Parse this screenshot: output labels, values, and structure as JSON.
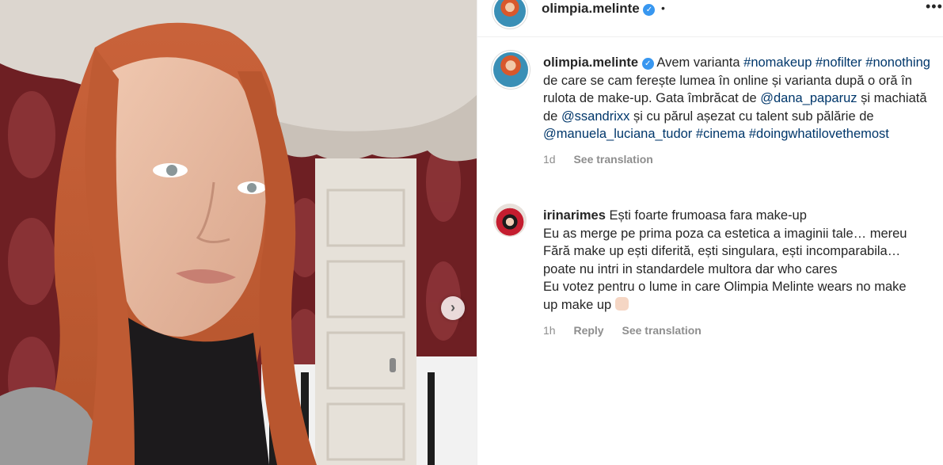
{
  "post": {
    "author": {
      "username": "olimpia.melinte",
      "verified": true
    },
    "header_separator": "•",
    "more_options": "•••",
    "caption": {
      "segments": [
        {
          "type": "text",
          "text": "Avem varianta "
        },
        {
          "type": "tag",
          "text": "#nomakeup"
        },
        {
          "type": "text",
          "text": " "
        },
        {
          "type": "tag",
          "text": "#nofilter"
        },
        {
          "type": "text",
          "text": " "
        },
        {
          "type": "tag",
          "text": "#nonothing"
        },
        {
          "type": "text",
          "text": " de care se cam ferește lumea în online și varianta după o oră în rulota de make-up. Gata îmbrăcat de "
        },
        {
          "type": "tag",
          "text": "@dana_paparuz"
        },
        {
          "type": "text",
          "text": " și machiată de "
        },
        {
          "type": "tag",
          "text": "@ssandrixx"
        },
        {
          "type": "text",
          "text": " și cu părul așezat cu talent sub pălărie de "
        },
        {
          "type": "tag",
          "text": "@manuela_luciana_tudor"
        },
        {
          "type": "text",
          "text": " "
        },
        {
          "type": "tag",
          "text": "#cinema"
        },
        {
          "type": "text",
          "text": " "
        },
        {
          "type": "tag",
          "text": "#doingwhatilovethemost"
        }
      ],
      "time": "1d",
      "see_translation": "See translation"
    }
  },
  "comment": {
    "username": "irinarimes",
    "lines": [
      "Ești foarte frumoasa fara make-up",
      "Eu as merge pe prima poza ca estetica a imaginii tale… mereu",
      "Fără make up ești diferită, ești singulara, ești incomparabila…",
      "poate nu intri in standardele multora dar who cares",
      "Eu votez pentru o lume in care Olimpia Melinte wears no make",
      "up make up"
    ],
    "emoji": "fist-emoji",
    "time": "1h",
    "reply": "Reply",
    "see_translation": "See translation"
  },
  "carousel": {
    "next_icon": "chevron-right-icon",
    "next_glyph": "›"
  },
  "colors": {
    "link": "#00376b",
    "verified": "#3897f0",
    "meta": "#8e8e8e"
  }
}
